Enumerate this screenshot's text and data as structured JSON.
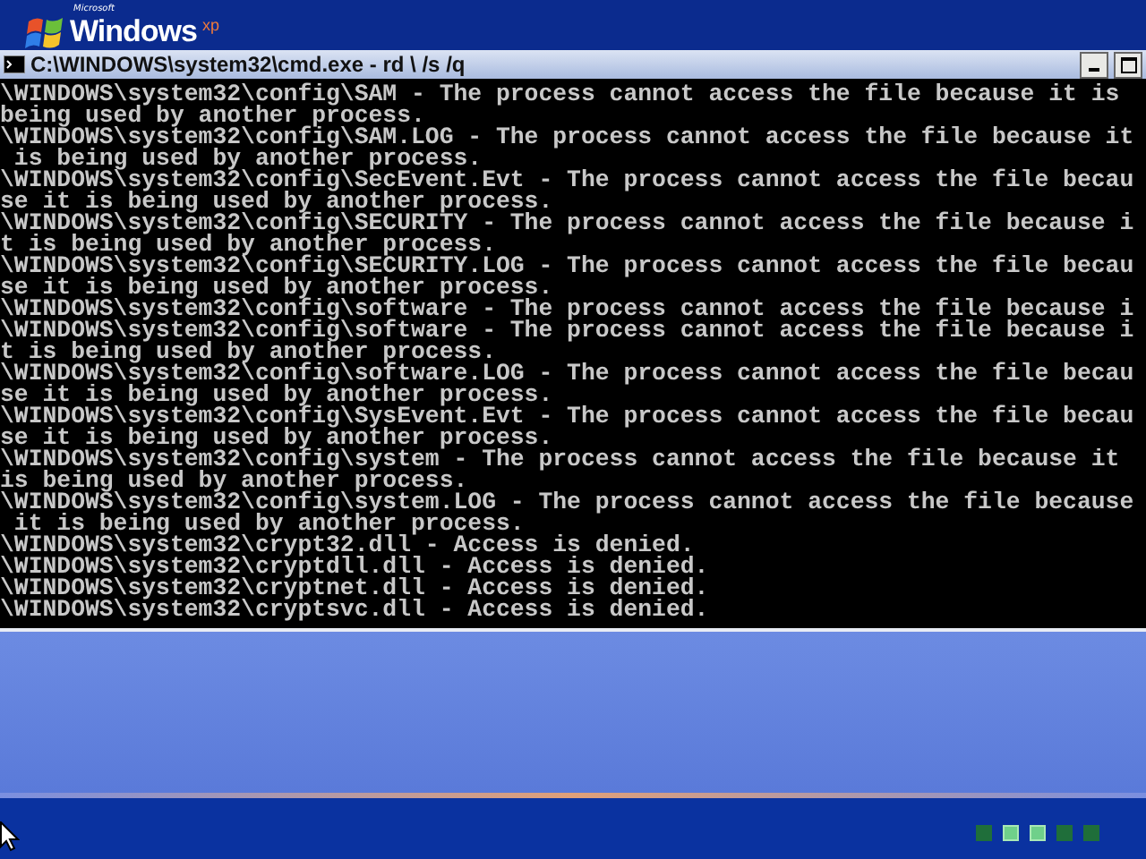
{
  "logo": {
    "maker": "Microsoft",
    "name": "Windows",
    "edition": "xp"
  },
  "window": {
    "title": "C:\\WINDOWS\\system32\\cmd.exe - rd \\ /s /q"
  },
  "console_lines": [
    "\\WINDOWS\\system32\\config\\SAM - The process cannot access the file because it is",
    "being used by another process.",
    "\\WINDOWS\\system32\\config\\SAM.LOG - The process cannot access the file because it",
    " is being used by another process.",
    "\\WINDOWS\\system32\\config\\SecEvent.Evt - The process cannot access the file becau",
    "se it is being used by another process.",
    "\\WINDOWS\\system32\\config\\SECURITY - The process cannot access the file because i",
    "t is being used by another process.",
    "\\WINDOWS\\system32\\config\\SECURITY.LOG - The process cannot access the file becau",
    "se it is being used by another process.",
    "\\WINDOWS\\system32\\config\\software - The process cannot access the file because i",
    "\\WINDOWS\\system32\\config\\software - The process cannot access the file because i",
    "t is being used by another process.",
    "\\WINDOWS\\system32\\config\\software.LOG - The process cannot access the file becau",
    "se it is being used by another process.",
    "\\WINDOWS\\system32\\config\\SysEvent.Evt - The process cannot access the file becau",
    "se it is being used by another process.",
    "\\WINDOWS\\system32\\config\\system - The process cannot access the file because it",
    "is being used by another process.",
    "\\WINDOWS\\system32\\config\\system.LOG - The process cannot access the file because",
    " it is being used by another process.",
    "\\WINDOWS\\system32\\crypt32.dll - Access is denied.",
    "\\WINDOWS\\system32\\cryptdll.dll - Access is denied.",
    "\\WINDOWS\\system32\\cryptnet.dll - Access is denied.",
    "\\WINDOWS\\system32\\cryptsvc.dll - Access is denied."
  ],
  "progress": [
    {
      "lit": false
    },
    {
      "lit": true
    },
    {
      "lit": true
    },
    {
      "lit": false
    },
    {
      "lit": false
    }
  ]
}
